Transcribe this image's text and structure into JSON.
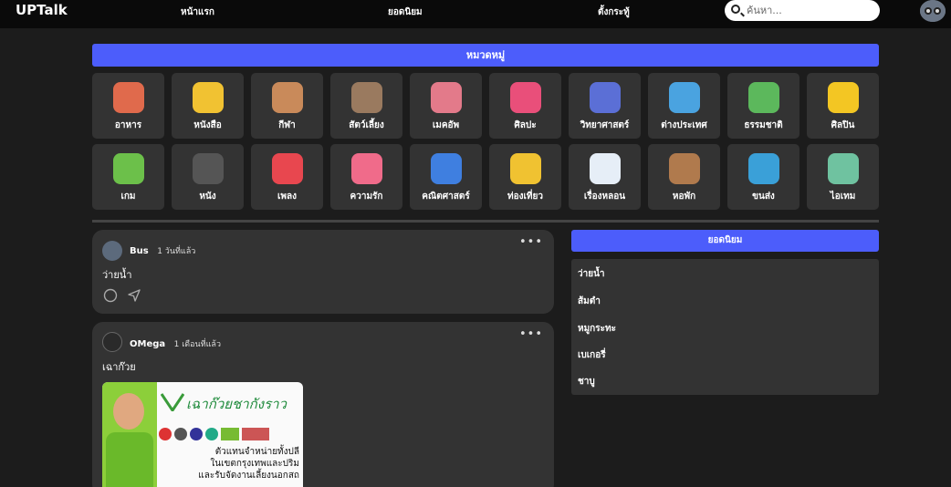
{
  "nav": {
    "logo": "UPTalk",
    "links": [
      "หน้าแรก",
      "ยอดนิยม",
      "ตั้งกระทู้"
    ],
    "search_placeholder": "ค้นหา..."
  },
  "categories": {
    "title": "หมวดหมู่",
    "items": [
      {
        "label": "อาหาร",
        "icon": "food-icon",
        "color": "#e06a4c"
      },
      {
        "label": "หนังสือ",
        "icon": "book-icon",
        "color": "#f1c232"
      },
      {
        "label": "กีฬา",
        "icon": "trophy-icon",
        "color": "#c98a5a"
      },
      {
        "label": "สัตว์เลี้ยง",
        "icon": "pets-icon",
        "color": "#9a7a5f"
      },
      {
        "label": "เมคอัพ",
        "icon": "makeup-icon",
        "color": "#e37a8a"
      },
      {
        "label": "ศิลปะ",
        "icon": "art-icon",
        "color": "#e94f7a"
      },
      {
        "label": "วิทยาศาสตร์",
        "icon": "science-icon",
        "color": "#5b6fd6"
      },
      {
        "label": "ต่างประเทศ",
        "icon": "globe-icon",
        "color": "#4aa3e0"
      },
      {
        "label": "ธรรมชาติ",
        "icon": "plant-icon",
        "color": "#5cb85c"
      },
      {
        "label": "ศิลปิน",
        "icon": "star-icon",
        "color": "#f3c623"
      },
      {
        "label": "เกม",
        "icon": "game-icon",
        "color": "#6cc04a"
      },
      {
        "label": "หนัง",
        "icon": "camera-icon",
        "color": "#555555"
      },
      {
        "label": "เพลง",
        "icon": "music-icon",
        "color": "#e8474f"
      },
      {
        "label": "ความรัก",
        "icon": "heart-icon",
        "color": "#f06b8a"
      },
      {
        "label": "คณิตศาสตร์",
        "icon": "calculator-icon",
        "color": "#3f7fe0"
      },
      {
        "label": "ท่องเที่ยว",
        "icon": "luggage-icon",
        "color": "#f0c231"
      },
      {
        "label": "เรื่องหลอน",
        "icon": "ghost-icon",
        "color": "#e6eef7"
      },
      {
        "label": "หอพัก",
        "icon": "building-icon",
        "color": "#b07a4d"
      },
      {
        "label": "ขนส่ง",
        "icon": "bus-icon",
        "color": "#3aa0d8"
      },
      {
        "label": "ไอเทม",
        "icon": "items-icon",
        "color": "#6fc2a0"
      }
    ]
  },
  "posts": [
    {
      "author": "Bus",
      "time": "1 วันที่แล้ว",
      "text": "ว่ายน้ำ"
    },
    {
      "author": "OMega",
      "time": "1 เดือนที่แล้ว",
      "text": "เฉาก๊วย",
      "ad": {
        "brand": "เฉาก๊วยชากังราว",
        "line1": "ตัวแทนจำหน่ายทั้งปลี",
        "line2": "ในเขตกรุงเทพและปริม",
        "line3": "และรับจัดงานเลี้ยงนอกสถ"
      }
    }
  ],
  "popular": {
    "title": "ยอดนิยม",
    "items": [
      "ว่ายน้ำ",
      "ส้มตำ",
      "หมูกระทะ",
      "เบเกอรี่",
      "ชาบู"
    ]
  },
  "colors": {
    "accent": "#4c5dfb",
    "card": "#333333",
    "background": "#1c1c1c"
  }
}
